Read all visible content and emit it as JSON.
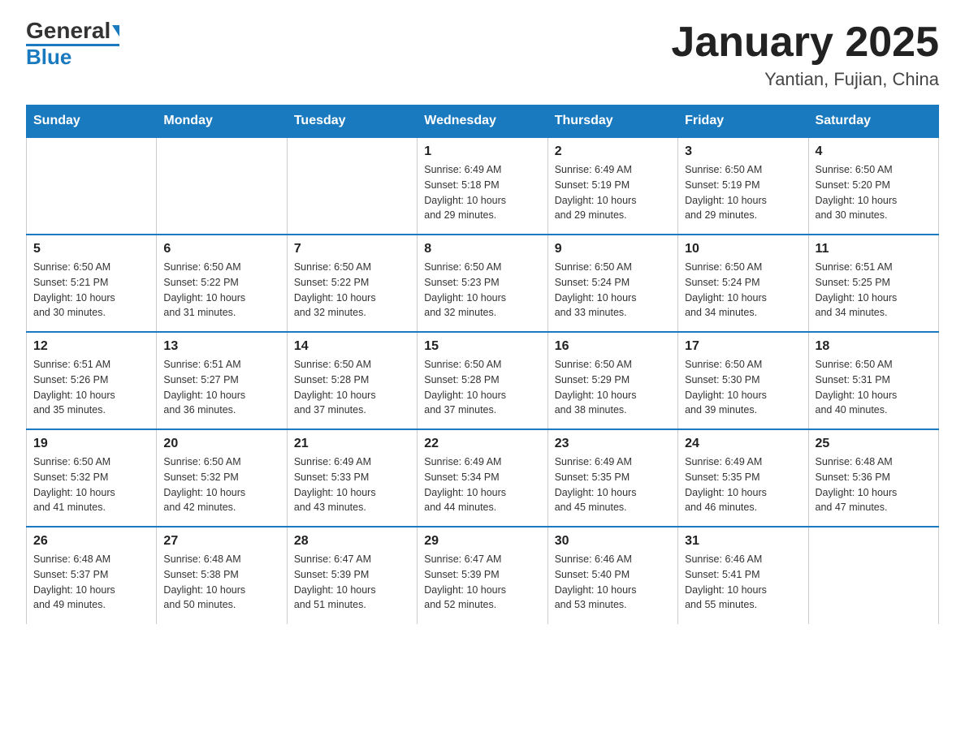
{
  "logo": {
    "text_general": "General",
    "text_blue": "Blue"
  },
  "header": {
    "title": "January 2025",
    "location": "Yantian, Fujian, China"
  },
  "days_of_week": [
    "Sunday",
    "Monday",
    "Tuesday",
    "Wednesday",
    "Thursday",
    "Friday",
    "Saturday"
  ],
  "weeks": [
    [
      {
        "day": "",
        "info": ""
      },
      {
        "day": "",
        "info": ""
      },
      {
        "day": "",
        "info": ""
      },
      {
        "day": "1",
        "info": "Sunrise: 6:49 AM\nSunset: 5:18 PM\nDaylight: 10 hours\nand 29 minutes."
      },
      {
        "day": "2",
        "info": "Sunrise: 6:49 AM\nSunset: 5:19 PM\nDaylight: 10 hours\nand 29 minutes."
      },
      {
        "day": "3",
        "info": "Sunrise: 6:50 AM\nSunset: 5:19 PM\nDaylight: 10 hours\nand 29 minutes."
      },
      {
        "day": "4",
        "info": "Sunrise: 6:50 AM\nSunset: 5:20 PM\nDaylight: 10 hours\nand 30 minutes."
      }
    ],
    [
      {
        "day": "5",
        "info": "Sunrise: 6:50 AM\nSunset: 5:21 PM\nDaylight: 10 hours\nand 30 minutes."
      },
      {
        "day": "6",
        "info": "Sunrise: 6:50 AM\nSunset: 5:22 PM\nDaylight: 10 hours\nand 31 minutes."
      },
      {
        "day": "7",
        "info": "Sunrise: 6:50 AM\nSunset: 5:22 PM\nDaylight: 10 hours\nand 32 minutes."
      },
      {
        "day": "8",
        "info": "Sunrise: 6:50 AM\nSunset: 5:23 PM\nDaylight: 10 hours\nand 32 minutes."
      },
      {
        "day": "9",
        "info": "Sunrise: 6:50 AM\nSunset: 5:24 PM\nDaylight: 10 hours\nand 33 minutes."
      },
      {
        "day": "10",
        "info": "Sunrise: 6:50 AM\nSunset: 5:24 PM\nDaylight: 10 hours\nand 34 minutes."
      },
      {
        "day": "11",
        "info": "Sunrise: 6:51 AM\nSunset: 5:25 PM\nDaylight: 10 hours\nand 34 minutes."
      }
    ],
    [
      {
        "day": "12",
        "info": "Sunrise: 6:51 AM\nSunset: 5:26 PM\nDaylight: 10 hours\nand 35 minutes."
      },
      {
        "day": "13",
        "info": "Sunrise: 6:51 AM\nSunset: 5:27 PM\nDaylight: 10 hours\nand 36 minutes."
      },
      {
        "day": "14",
        "info": "Sunrise: 6:50 AM\nSunset: 5:28 PM\nDaylight: 10 hours\nand 37 minutes."
      },
      {
        "day": "15",
        "info": "Sunrise: 6:50 AM\nSunset: 5:28 PM\nDaylight: 10 hours\nand 37 minutes."
      },
      {
        "day": "16",
        "info": "Sunrise: 6:50 AM\nSunset: 5:29 PM\nDaylight: 10 hours\nand 38 minutes."
      },
      {
        "day": "17",
        "info": "Sunrise: 6:50 AM\nSunset: 5:30 PM\nDaylight: 10 hours\nand 39 minutes."
      },
      {
        "day": "18",
        "info": "Sunrise: 6:50 AM\nSunset: 5:31 PM\nDaylight: 10 hours\nand 40 minutes."
      }
    ],
    [
      {
        "day": "19",
        "info": "Sunrise: 6:50 AM\nSunset: 5:32 PM\nDaylight: 10 hours\nand 41 minutes."
      },
      {
        "day": "20",
        "info": "Sunrise: 6:50 AM\nSunset: 5:32 PM\nDaylight: 10 hours\nand 42 minutes."
      },
      {
        "day": "21",
        "info": "Sunrise: 6:49 AM\nSunset: 5:33 PM\nDaylight: 10 hours\nand 43 minutes."
      },
      {
        "day": "22",
        "info": "Sunrise: 6:49 AM\nSunset: 5:34 PM\nDaylight: 10 hours\nand 44 minutes."
      },
      {
        "day": "23",
        "info": "Sunrise: 6:49 AM\nSunset: 5:35 PM\nDaylight: 10 hours\nand 45 minutes."
      },
      {
        "day": "24",
        "info": "Sunrise: 6:49 AM\nSunset: 5:35 PM\nDaylight: 10 hours\nand 46 minutes."
      },
      {
        "day": "25",
        "info": "Sunrise: 6:48 AM\nSunset: 5:36 PM\nDaylight: 10 hours\nand 47 minutes."
      }
    ],
    [
      {
        "day": "26",
        "info": "Sunrise: 6:48 AM\nSunset: 5:37 PM\nDaylight: 10 hours\nand 49 minutes."
      },
      {
        "day": "27",
        "info": "Sunrise: 6:48 AM\nSunset: 5:38 PM\nDaylight: 10 hours\nand 50 minutes."
      },
      {
        "day": "28",
        "info": "Sunrise: 6:47 AM\nSunset: 5:39 PM\nDaylight: 10 hours\nand 51 minutes."
      },
      {
        "day": "29",
        "info": "Sunrise: 6:47 AM\nSunset: 5:39 PM\nDaylight: 10 hours\nand 52 minutes."
      },
      {
        "day": "30",
        "info": "Sunrise: 6:46 AM\nSunset: 5:40 PM\nDaylight: 10 hours\nand 53 minutes."
      },
      {
        "day": "31",
        "info": "Sunrise: 6:46 AM\nSunset: 5:41 PM\nDaylight: 10 hours\nand 55 minutes."
      },
      {
        "day": "",
        "info": ""
      }
    ]
  ]
}
